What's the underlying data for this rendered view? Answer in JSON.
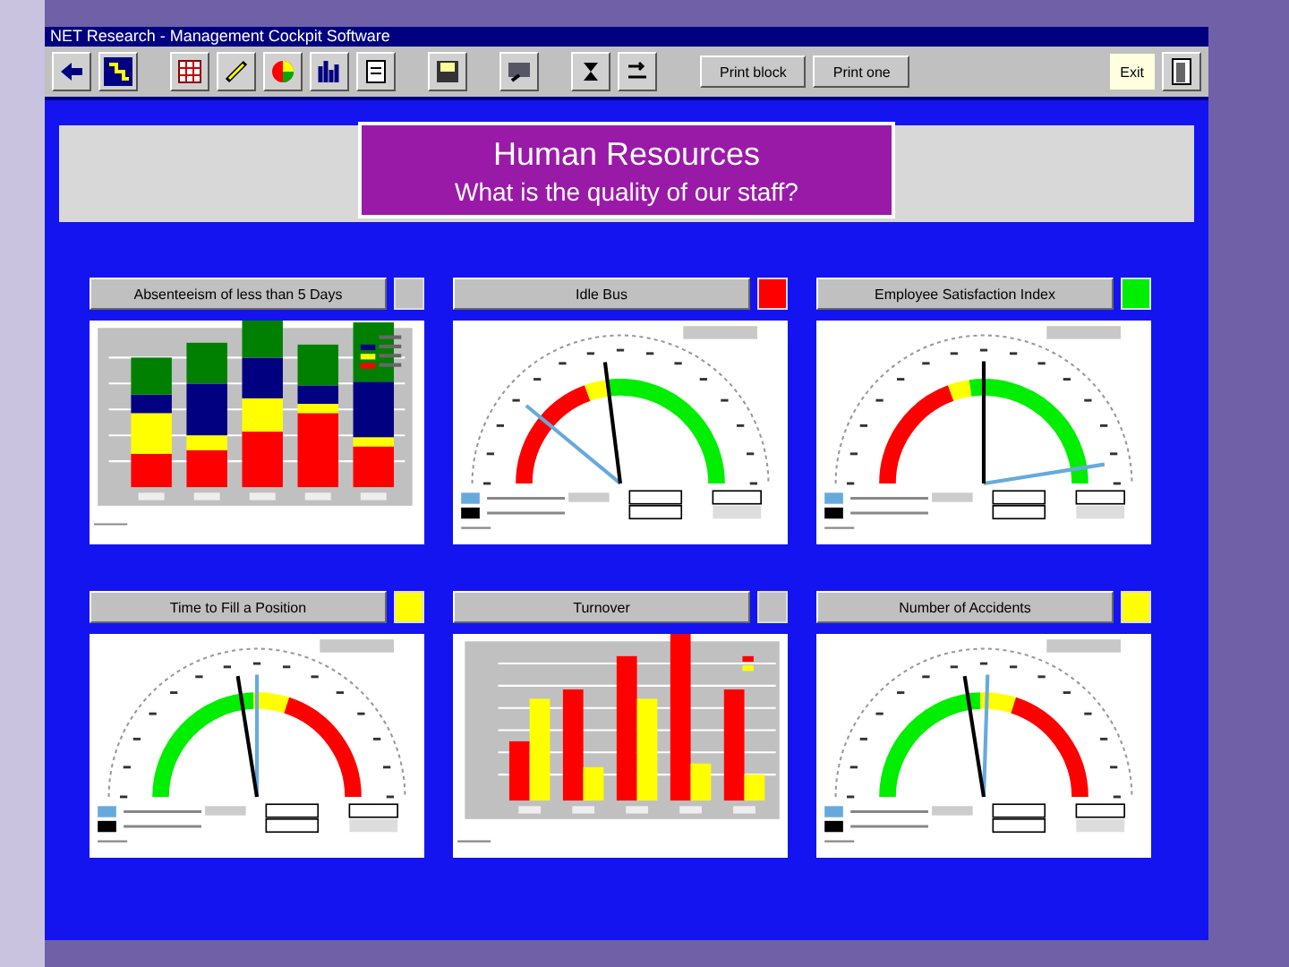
{
  "window": {
    "title": "NET Research - Management Cockpit Software"
  },
  "toolbar": {
    "buttons": [
      {
        "label": "Print block"
      },
      {
        "label": "Print one"
      }
    ],
    "exit": "Exit"
  },
  "banner": {
    "title": "Human Resources",
    "subtitle": "What is the quality of our staff?"
  },
  "panels": [
    {
      "title": "Absenteeism of less than 5 Days",
      "color": "#c0c0c0",
      "kind": "stacked-bars"
    },
    {
      "title": "Idle Bus",
      "color": "#ff0000",
      "kind": "gauge"
    },
    {
      "title": "Employee Satisfaction Index",
      "color": "#00ee00",
      "kind": "gauge"
    },
    {
      "title": "Time to Fill a Position",
      "color": "#ffff00",
      "kind": "reverse-gauge"
    },
    {
      "title": "Turnover",
      "color": "#c0c0c0",
      "kind": "bars"
    },
    {
      "title": "Number of Accidents",
      "color": "#ffff00",
      "kind": "reverse-gauge"
    }
  ]
}
